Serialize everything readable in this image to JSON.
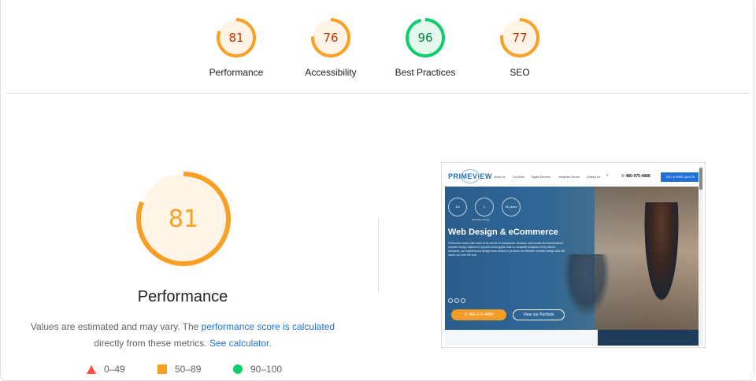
{
  "colors": {
    "average": "#fa9f23",
    "average_bg": "#fff4e6",
    "average_text": "#c33300",
    "pass": "#0cce6b",
    "pass_bg": "#e6f8ee",
    "pass_text": "#018642",
    "fail": "#ff4e42",
    "link": "#1a73e8"
  },
  "categories": [
    {
      "label": "Performance",
      "score": "81",
      "value": 81,
      "rating": "average"
    },
    {
      "label": "Accessibility",
      "score": "76",
      "value": 76,
      "rating": "average"
    },
    {
      "label": "Best Practices",
      "score": "96",
      "value": 96,
      "rating": "pass"
    },
    {
      "label": "SEO",
      "score": "77",
      "value": 77,
      "rating": "average"
    }
  ],
  "performance": {
    "score": "81",
    "value": 81,
    "title": "Performance",
    "desc_prefix": "Values are estimated and may vary. The ",
    "link_score": "performance score is calculated",
    "desc_mid": "directly from these metrics.",
    "link_calculator": "See calculator",
    "desc_end": "."
  },
  "legend": [
    {
      "range": "0–49",
      "icon": "red-triangle-icon"
    },
    {
      "range": "50–89",
      "icon": "orange-square-icon"
    },
    {
      "range": "90–100",
      "icon": "green-circle-icon"
    }
  ],
  "screenshot": {
    "logo": "PRIMEVIEW",
    "nav_links": [
      "About Us",
      "Our Work",
      "Digital Services",
      "Industries Served",
      "Contact Us"
    ],
    "phone": "480-970-4888",
    "cta": "GET A FREE QUOTE",
    "badge_1": "1st",
    "badge_3": "25 years",
    "badge_caption": "Web Best Design",
    "hero_title": "Web Design & eCommerce",
    "hero_text": "Primeview works with each of its clients to brainstorm, develop, and create an individualized website design tailored to specific client goals. After a complete analysis of the client's business, our experienced design team works to produce an effective website design that will stand out from the rest.",
    "button_phone": "480-970-4888",
    "button_portfolio": "View our Portfolio"
  }
}
